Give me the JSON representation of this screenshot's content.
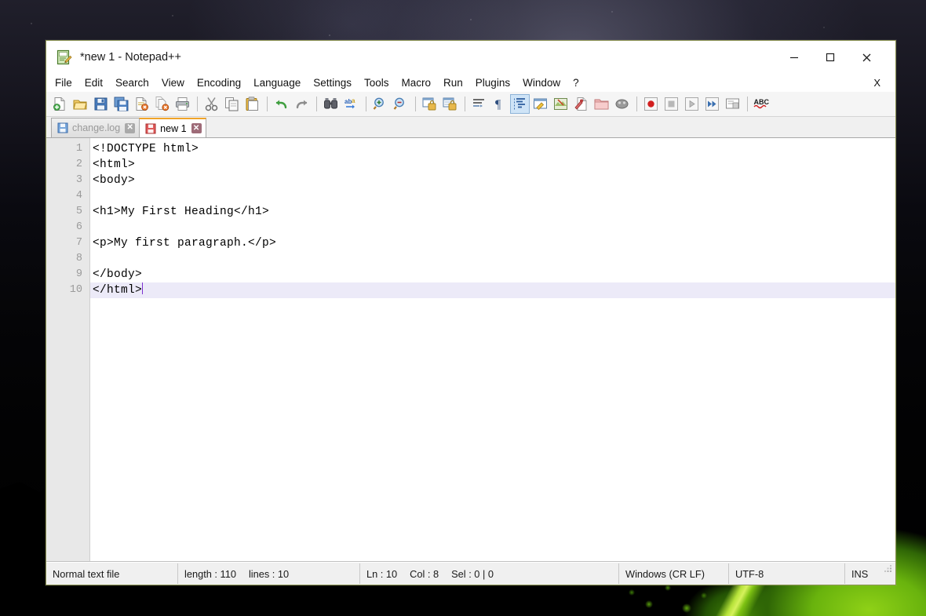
{
  "window": {
    "title": "*new 1 - Notepad++",
    "app_icon": "notepad-pencil-icon",
    "minimize_label": "—",
    "maximize_label": "□",
    "close_label": "✕",
    "menu_close_label": "X"
  },
  "menu": {
    "items": [
      {
        "label": "File"
      },
      {
        "label": "Edit"
      },
      {
        "label": "Search"
      },
      {
        "label": "View"
      },
      {
        "label": "Encoding"
      },
      {
        "label": "Language"
      },
      {
        "label": "Settings"
      },
      {
        "label": "Tools"
      },
      {
        "label": "Macro"
      },
      {
        "label": "Run"
      },
      {
        "label": "Plugins"
      },
      {
        "label": "Window"
      },
      {
        "label": "?"
      }
    ]
  },
  "toolbar": {
    "buttons": [
      {
        "name": "new-file-icon",
        "type": "icon"
      },
      {
        "name": "open-file-icon",
        "type": "icon"
      },
      {
        "name": "save-icon",
        "type": "icon"
      },
      {
        "name": "save-all-icon",
        "type": "icon"
      },
      {
        "name": "close-file-icon",
        "type": "icon"
      },
      {
        "name": "close-all-files-icon",
        "type": "icon"
      },
      {
        "name": "print-icon",
        "type": "icon"
      },
      {
        "name": "separator",
        "type": "sep"
      },
      {
        "name": "cut-icon",
        "type": "icon"
      },
      {
        "name": "copy-icon",
        "type": "icon"
      },
      {
        "name": "paste-icon",
        "type": "icon"
      },
      {
        "name": "separator",
        "type": "sep"
      },
      {
        "name": "undo-icon",
        "type": "icon"
      },
      {
        "name": "redo-icon",
        "type": "icon"
      },
      {
        "name": "separator",
        "type": "sep"
      },
      {
        "name": "find-icon",
        "type": "icon"
      },
      {
        "name": "replace-icon",
        "type": "icon"
      },
      {
        "name": "separator",
        "type": "sep"
      },
      {
        "name": "zoom-in-icon",
        "type": "icon"
      },
      {
        "name": "zoom-out-icon",
        "type": "icon"
      },
      {
        "name": "separator",
        "type": "sep"
      },
      {
        "name": "sync-vertical-scroll-icon",
        "type": "icon"
      },
      {
        "name": "sync-horizontal-scroll-icon",
        "type": "icon"
      },
      {
        "name": "separator",
        "type": "sep"
      },
      {
        "name": "word-wrap-icon",
        "type": "icon"
      },
      {
        "name": "show-all-characters-icon",
        "type": "icon"
      },
      {
        "name": "show-indent-guide-icon",
        "type": "icon",
        "active": true
      },
      {
        "name": "user-defined-dialog-icon",
        "type": "icon"
      },
      {
        "name": "document-map-icon",
        "type": "icon"
      },
      {
        "name": "function-list-icon",
        "type": "icon"
      },
      {
        "name": "folder-as-workspace-icon",
        "type": "icon"
      },
      {
        "name": "monitoring-icon",
        "type": "icon"
      },
      {
        "name": "separator",
        "type": "sep"
      },
      {
        "name": "start-record-macro-icon",
        "type": "icon"
      },
      {
        "name": "stop-record-macro-icon",
        "type": "icon"
      },
      {
        "name": "play-macro-icon",
        "type": "icon"
      },
      {
        "name": "run-macro-multiple-icon",
        "type": "icon"
      },
      {
        "name": "save-macro-icon",
        "type": "icon"
      },
      {
        "name": "separator",
        "type": "sep"
      },
      {
        "name": "spell-check-icon",
        "type": "icon"
      }
    ]
  },
  "tabs": [
    {
      "label": "change.log",
      "active": false,
      "icon": "save-blue-icon",
      "close_label": "✕"
    },
    {
      "label": "new 1",
      "active": true,
      "icon": "save-red-icon",
      "close_label": "✕"
    }
  ],
  "editor": {
    "lines": [
      {
        "number": "1",
        "text": "<!DOCTYPE html>"
      },
      {
        "number": "2",
        "text": "<html>"
      },
      {
        "number": "3",
        "text": "<body>"
      },
      {
        "number": "4",
        "text": ""
      },
      {
        "number": "5",
        "text": "<h1>My First Heading</h1>"
      },
      {
        "number": "6",
        "text": ""
      },
      {
        "number": "7",
        "text": "<p>My first paragraph.</p>"
      },
      {
        "number": "8",
        "text": ""
      },
      {
        "number": "9",
        "text": "</body>"
      },
      {
        "number": "10",
        "text": "</html>",
        "current": true,
        "caret": true
      }
    ]
  },
  "status_bar": {
    "file_type": "Normal text file",
    "length_label": "length : 110",
    "lines_label": "lines : 10",
    "ln_label": "Ln : 10",
    "col_label": "Col : 8",
    "sel_label": "Sel : 0 | 0",
    "eol": "Windows (CR LF)",
    "encoding": "UTF-8",
    "insert_mode": "INS"
  },
  "colors": {
    "accent_tab_active": "#f0a428",
    "caret": "#7b2fd0",
    "current_line": "#eceaf8",
    "toolbar_active": "#cfe4f7",
    "window_border": "#8a9150",
    "gutter": "#e8e8e8"
  }
}
